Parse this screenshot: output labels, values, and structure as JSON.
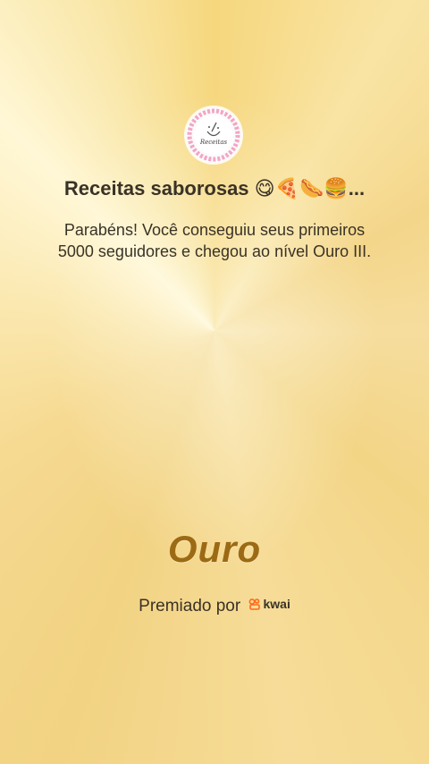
{
  "profile": {
    "name": "Receitas saborosas 😋🍕🌭🍔...",
    "avatar_text": "Receitas"
  },
  "message": {
    "line1": "Parabéns! Você conseguiu seus primeiros",
    "line2": "5000 seguidores e chegou ao nível Ouro III."
  },
  "level": {
    "label": "Ouro"
  },
  "award": {
    "label": "Premiado por",
    "brand": "kwai",
    "brand_icon": "kwai-logo-icon"
  },
  "colors": {
    "gold": "#9c6a14",
    "brand": "#ff6a1a",
    "text": "#3a3226"
  }
}
